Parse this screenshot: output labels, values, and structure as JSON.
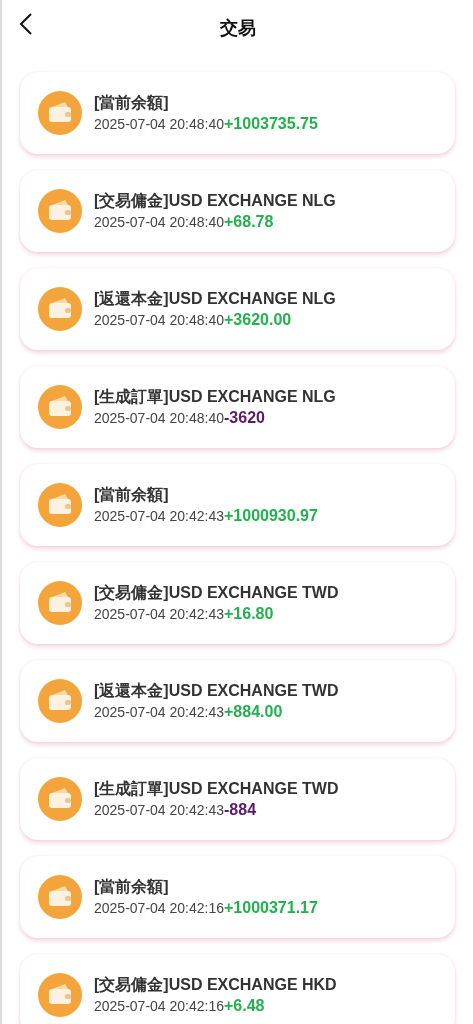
{
  "header": {
    "title": "交易"
  },
  "transactions": [
    {
      "title": "[當前余額]",
      "time": "2025-07-04 20:48:40",
      "amount": "+1003735.75",
      "kind": "credit"
    },
    {
      "title": "[交易傭金]USD EXCHANGE NLG",
      "time": "2025-07-04 20:48:40",
      "amount": "+68.78",
      "kind": "credit"
    },
    {
      "title": "[返還本金]USD EXCHANGE NLG",
      "time": "2025-07-04 20:48:40",
      "amount": "+3620.00",
      "kind": "credit"
    },
    {
      "title": "[生成訂單]USD EXCHANGE NLG",
      "time": "2025-07-04 20:48:40",
      "amount": "-3620",
      "kind": "debit"
    },
    {
      "title": "[當前余額]",
      "time": "2025-07-04 20:42:43",
      "amount": "+1000930.97",
      "kind": "credit"
    },
    {
      "title": "[交易傭金]USD EXCHANGE TWD",
      "time": "2025-07-04 20:42:43",
      "amount": "+16.80",
      "kind": "credit"
    },
    {
      "title": "[返還本金]USD EXCHANGE TWD",
      "time": "2025-07-04 20:42:43",
      "amount": "+884.00",
      "kind": "credit"
    },
    {
      "title": "[生成訂單]USD EXCHANGE TWD",
      "time": "2025-07-04 20:42:43",
      "amount": "-884",
      "kind": "debit"
    },
    {
      "title": "[當前余額]",
      "time": "2025-07-04 20:42:16",
      "amount": "+1000371.17",
      "kind": "credit"
    },
    {
      "title": "[交易傭金]USD EXCHANGE HKD",
      "time": "2025-07-04 20:42:16",
      "amount": "+6.48",
      "kind": "credit"
    }
  ]
}
